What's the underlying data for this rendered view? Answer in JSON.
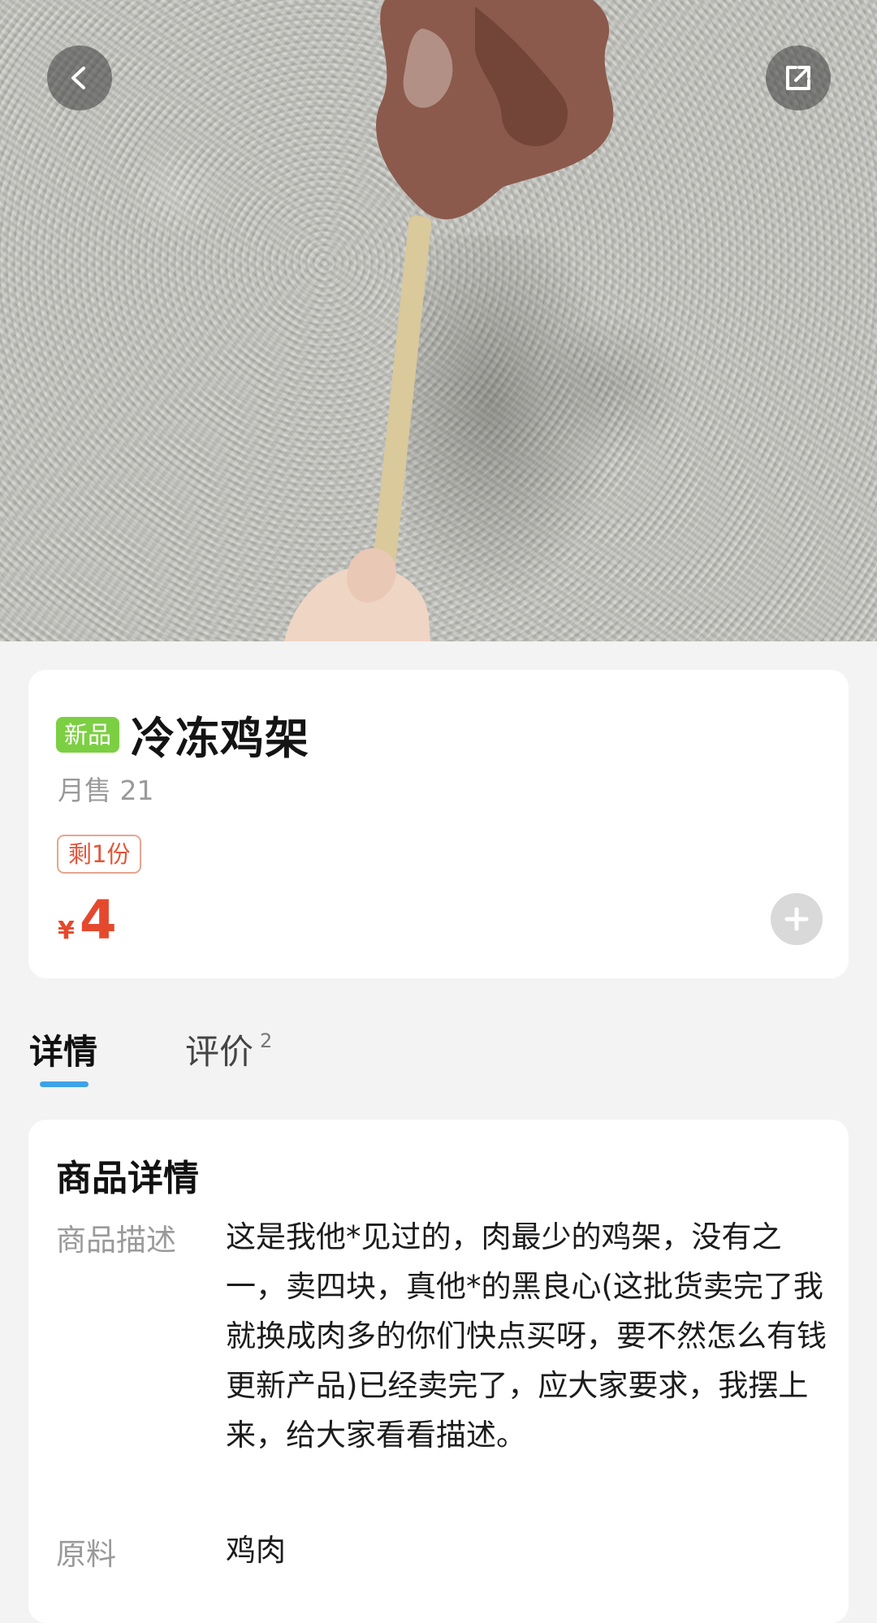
{
  "product": {
    "badge": "新品",
    "title": "冷冻鸡架",
    "monthly_sales_label": "月售 21",
    "stock_label": "剩1份",
    "currency": "¥",
    "price": "4"
  },
  "tabs": [
    {
      "label": "详情",
      "active": true
    },
    {
      "label": "评价",
      "count": "2",
      "active": false
    }
  ],
  "details": {
    "heading": "商品详情",
    "description_label": "商品描述",
    "description": "这是我他*见过的，肉最少的鸡架，没有之一，卖四块，真他*的黑良心(这批货卖完了我就换成肉多的你们快点买呀，要不然怎么有钱更新产品)已经卖完了，应大家要求，我摆上来，给大家看看描述。",
    "material_label": "原料",
    "material": "鸡肉"
  },
  "icons": {
    "back": "chevron-left-icon",
    "share": "share-external-icon",
    "add": "plus-icon"
  },
  "colors": {
    "accent": "#3ea2e8",
    "price": "#e5492d",
    "new_badge": "#7ccf42"
  }
}
